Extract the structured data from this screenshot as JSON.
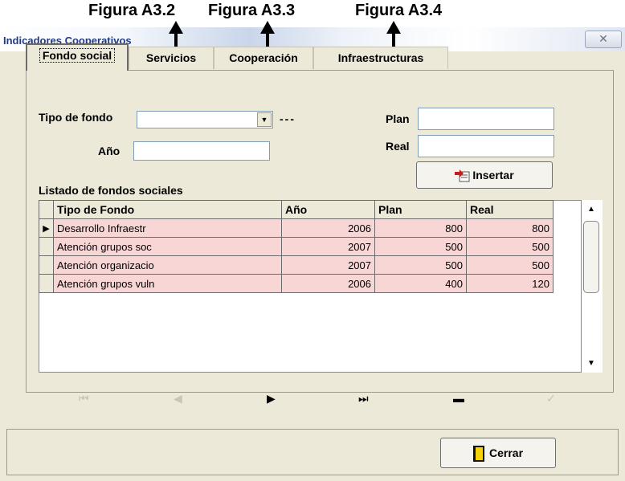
{
  "annotations": {
    "fig1": "Figura A3.2",
    "fig2": "Figura A3.3",
    "fig3": "Figura A3.4"
  },
  "window": {
    "title": "Indicadores Cooperativos",
    "close": "✕"
  },
  "tabs": [
    {
      "label": "Fondo social",
      "active": true
    },
    {
      "label": "Servicios",
      "active": false
    },
    {
      "label": "Cooperación",
      "active": false
    },
    {
      "label": "Infraestructuras",
      "active": false
    }
  ],
  "form": {
    "tipo_label": "Tipo de fondo",
    "tipo_value": "",
    "dots": "---",
    "anio_label": "Año",
    "anio_value": "",
    "plan_label": "Plan",
    "plan_value": "",
    "real_label": "Real",
    "real_value": "",
    "insert_label": "Insertar"
  },
  "list": {
    "title": "Listado de fondos sociales",
    "columns": [
      "Tipo de Fondo",
      "Año",
      "Plan",
      "Real"
    ],
    "rows": [
      {
        "tipo": "Desarrollo Infraestr",
        "anio": "2006",
        "plan": "800",
        "real": "800"
      },
      {
        "tipo": "Atención grupos soc",
        "anio": "2007",
        "plan": "500",
        "real": "500"
      },
      {
        "tipo": "Atención organizacio",
        "anio": "2007",
        "plan": "500",
        "real": "500"
      },
      {
        "tipo": "Atención grupos vuln",
        "anio": "2006",
        "plan": "400",
        "real": "120"
      }
    ]
  },
  "navigator": {
    "first": "⏮",
    "prior": "◀",
    "next": "▶",
    "last": "⏭",
    "delete": "▬",
    "post": "✓"
  },
  "footer": {
    "close_label": "Cerrar"
  },
  "colors": {
    "row_bg": "#f9d6d6",
    "window_bg": "#ece9d8"
  }
}
